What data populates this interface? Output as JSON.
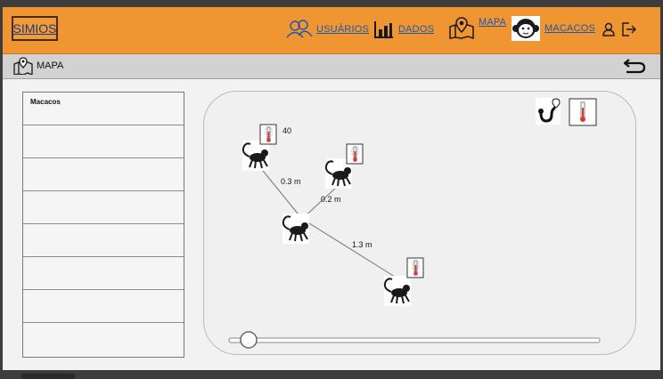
{
  "brand": "SIMIOS",
  "nav": {
    "users": "USUÁRIOS",
    "data": "DADOS",
    "map": "MAPA",
    "monkeys": "MACACOS"
  },
  "page_title": "MAPA",
  "list": {
    "header": "Macacos",
    "rows": [
      "",
      "",
      "",
      "",
      "",
      "",
      ""
    ]
  },
  "map": {
    "temperature_label": "40",
    "distances": [
      "0.3 m",
      "0.2 m",
      "1.3 m"
    ]
  },
  "slider": {
    "value": 0
  }
}
